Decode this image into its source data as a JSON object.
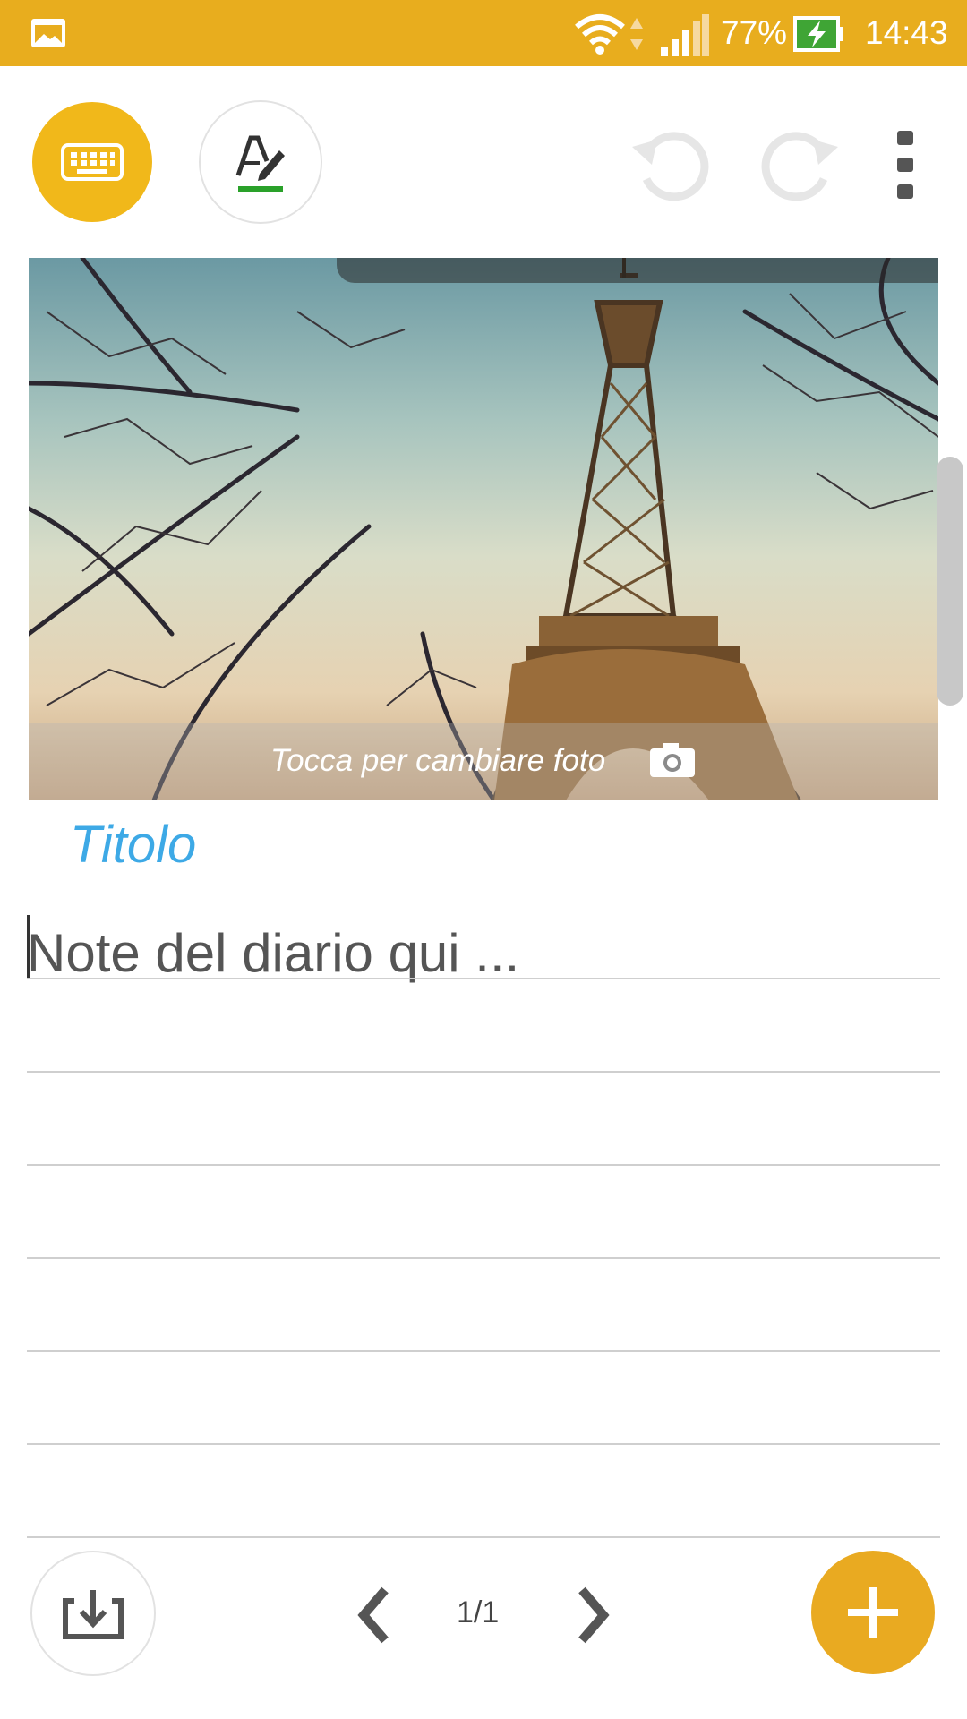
{
  "status_bar": {
    "battery_percent": "77%",
    "time": "14:43",
    "icons": [
      "gallery-icon",
      "wifi-icon",
      "data-arrows-icon",
      "signal-icon",
      "battery-charging-icon"
    ]
  },
  "toolbar": {
    "keyboard_icon": "keyboard-icon",
    "handwriting_icon": "handwriting-pen-icon",
    "undo_icon": "undo-icon",
    "redo_icon": "redo-icon",
    "more_icon": "more-vertical-icon"
  },
  "photo": {
    "caption": "Tocca per cambiare foto",
    "camera_icon": "camera-icon"
  },
  "entry": {
    "title_placeholder": "Titolo",
    "body_placeholder": "Note del diario qui ..."
  },
  "bottom_bar": {
    "save_icon": "save-to-device-icon",
    "page_indicator": "1/1",
    "prev_icon": "chevron-left-icon",
    "next_icon": "chevron-right-icon",
    "add_icon": "plus-icon"
  },
  "colors": {
    "status_bar": "#E8AD1E",
    "accent": "#F1B81A",
    "title": "#3DA9E6",
    "pen_underline": "#2AA12A"
  }
}
